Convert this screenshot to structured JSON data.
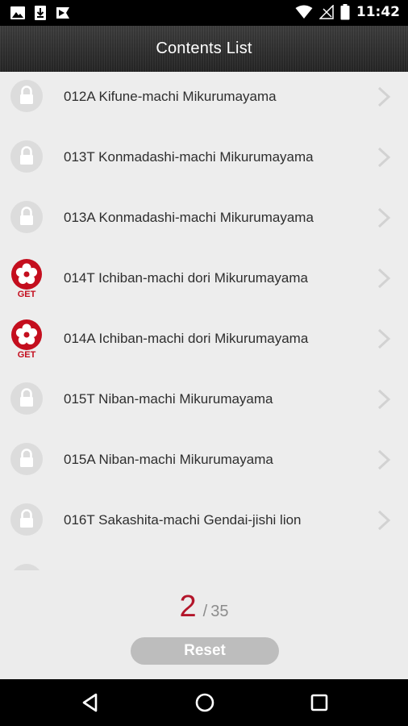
{
  "status_bar": {
    "time": "11:42",
    "left_icons": [
      "image-icon",
      "download-icon",
      "play-store-icon"
    ],
    "right_icons": [
      "wifi-icon",
      "no-signal-icon",
      "battery-icon"
    ]
  },
  "header": {
    "title": "Contents List"
  },
  "list": {
    "items": [
      {
        "label": "012A Kifune-machi Mikurumayama",
        "status": "locked"
      },
      {
        "label": "013T Konmadashi-machi Mikurumayama",
        "status": "locked"
      },
      {
        "label": "013A Konmadashi-machi Mikurumayama",
        "status": "locked"
      },
      {
        "label": "014T Ichiban-machi dori Mikurumayama",
        "status": "get",
        "badge": "GET"
      },
      {
        "label": "014A Ichiban-machi dori Mikurumayama",
        "status": "get",
        "badge": "GET"
      },
      {
        "label": "015T Niban-machi Mikurumayama",
        "status": "locked"
      },
      {
        "label": "015A Niban-machi Mikurumayama",
        "status": "locked"
      },
      {
        "label": "016T Sakashita-machi Gendai-jishi lion",
        "status": "locked"
      }
    ]
  },
  "footer": {
    "collected": "2",
    "separator": "/",
    "total": "35",
    "reset_label": "Reset"
  },
  "colors": {
    "accent": "#b3152a",
    "lock": "#dcdcdc",
    "chevron": "#d2d2d2",
    "button": "#bdbdbd"
  },
  "navigation_bar": {
    "buttons": [
      "back-icon",
      "home-icon",
      "recents-icon"
    ]
  }
}
